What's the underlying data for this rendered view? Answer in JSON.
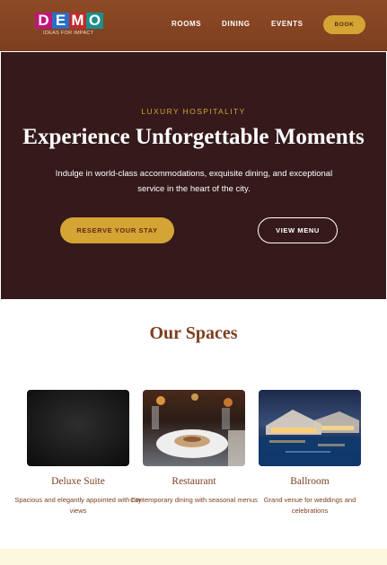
{
  "brand": {
    "letters": [
      "D",
      "E",
      "M",
      "O"
    ],
    "letter_colors": [
      "#c0167a",
      "#2a6fc4",
      "#c12a2a",
      "#1e8f8a"
    ],
    "tagline": "IDEAS FOR IMPACT"
  },
  "nav": {
    "items": [
      "ROOMS",
      "DINING",
      "EVENTS"
    ],
    "book_label": "BOOK"
  },
  "hero": {
    "eyebrow": "LUXURY HOSPITALITY",
    "title": "Experience Unforgettable Moments",
    "subtitle": "Indulge in world-class accommodations, exquisite dining, and exceptional service in the heart of the city.",
    "primary_cta": "RESERVE YOUR STAY",
    "secondary_cta": "VIEW MENU"
  },
  "spaces": {
    "title": "Our Spaces",
    "cards": [
      {
        "title": "Deluxe Suite",
        "description": "Spacious and elegantly appointed with city views"
      },
      {
        "title": "Restaurant",
        "description": "Contemporary dining with seasonal menus"
      },
      {
        "title": "Ballroom",
        "description": "Grand venue for weddings and celebrations"
      }
    ]
  },
  "colors": {
    "header_bg": "#7c3f1f",
    "hero_bg": "#35191b",
    "accent_gold": "#d4a435",
    "text_brown": "#7c3f1f",
    "footer_band": "#fcf6dc"
  }
}
